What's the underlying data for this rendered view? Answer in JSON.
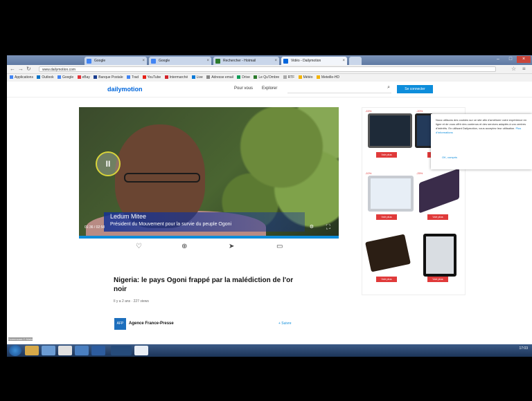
{
  "browser": {
    "tabs": [
      {
        "label": "Google",
        "color": "#4285f4"
      },
      {
        "label": "Google",
        "color": "#4285f4"
      },
      {
        "label": "Rechercher - Hotmail",
        "color": "#2c7a2c"
      },
      {
        "label": "Vidéo - Dailymotion",
        "color": "#0066dc"
      }
    ],
    "url": "www.dailymotion.com",
    "bookmarks": [
      "Applications",
      "Outlook",
      "Google",
      "eBay",
      "Banque Postale",
      "Trad",
      "YouTube",
      "Intermarché",
      "Live",
      "Adresse email",
      "Drive",
      "Le Qu'Ombre",
      "RTF",
      "Météo",
      "Meteille-HD"
    ]
  },
  "site": {
    "logo": "dailymotion",
    "nav": [
      "Pour vous",
      "Explorer"
    ],
    "signup": "Se connecter"
  },
  "player": {
    "name_caption": "Ledum Mitee",
    "title_caption": "Président du Mouvement pour la survie du peuple Ogoni",
    "time": "01:36 / 02:58",
    "progress": 1.0
  },
  "video": {
    "title": "Nigeria: le pays Ogoni frappé par la malédiction de l'or noir",
    "meta": "Il y a 2 ans · 227 views",
    "channel": "Agence France-Presse",
    "follow": "+ Suivre"
  },
  "ads": {
    "button": "Voir plus",
    "colors": [
      "#1e2a38",
      "#233a5a",
      "#e7eef6",
      "#3a2c4a",
      "#2b1e14",
      "#d9dde2"
    ]
  },
  "cookie": {
    "text": "Nous utilisons des cookies sur ce site afin d'améliorer votre expérience en ligne et de vous offrir des contenus et des services adaptés à vos centres d'intérêts. En utilisant Dailymotion, vous acceptez leur utilisation.",
    "link": "Plus d'informations",
    "ok": "OK, compris"
  },
  "taskbar": {
    "recorder": "Screencast-O-Matic",
    "time": "17:03"
  }
}
